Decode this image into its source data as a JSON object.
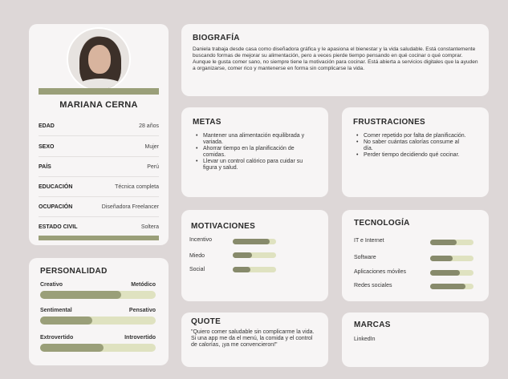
{
  "profile": {
    "name": "MARIANA CERNA",
    "info": [
      {
        "label": "EDAD",
        "value": "28 años"
      },
      {
        "label": "SEXO",
        "value": "Mujer"
      },
      {
        "label": "PAÍS",
        "value": "Perú"
      },
      {
        "label": "EDUCACIÓN",
        "value": "Técnica completa"
      },
      {
        "label": "OCUPACIÓN",
        "value": "Diseñadora Freelancer"
      },
      {
        "label": "ESTADO CIVIL",
        "value": "Soltera"
      }
    ]
  },
  "personalidad": {
    "title": "PERSONALIDAD",
    "traits": [
      {
        "left": "Creativo",
        "right": "Metódico",
        "level": 0.7
      },
      {
        "left": "Sentimental",
        "right": "Pensativo",
        "level": 0.45
      },
      {
        "left": "Extrovertido",
        "right": "Introvertido",
        "level": 0.55
      }
    ]
  },
  "biografia": {
    "title": "BIOGRAFÍA",
    "text": "Daniela trabaja desde casa como diseñadora gráfica y le apasiona el bienestar y la vida saludable. Está constantemente buscando formas de mejorar su alimentación, pero a veces pierde tiempo pensando en qué cocinar o qué comprar. Aunque le gusta comer sano, no siempre tiene la motivación para cocinar. Está abierta a servicios digitales que la ayuden a organizarse, comer rico y mantenerse en forma sin complicarse la vida."
  },
  "metas": {
    "title": "METAS",
    "items": [
      "Mantener una alimentación equilibrada y variada.",
      "Ahorrar tiempo en la planificación de comidas.",
      "Llevar un control calórico para cuidar su figura y salud."
    ]
  },
  "frustraciones": {
    "title": "FRUSTRACIONES",
    "items": [
      "Comer repetido por falta de planificación.",
      "No saber cuántas calorías consume al día.",
      "Perder tiempo decidiendo qué cocinar."
    ]
  },
  "motivaciones": {
    "title": "MOTIVACIONES",
    "items": [
      {
        "label": "Incentivo",
        "level": 0.85
      },
      {
        "label": "Miedo",
        "level": 0.45
      },
      {
        "label": "Social",
        "level": 0.4
      }
    ]
  },
  "tecnologia": {
    "title": "TECNOLOGÍA",
    "items": [
      {
        "label": "IT e Internet",
        "level": 0.62
      },
      {
        "label": "Software",
        "level": 0.52
      },
      {
        "label": "Aplicaciones móviles",
        "level": 0.68
      },
      {
        "label": "Redes sociales",
        "level": 0.82
      }
    ]
  },
  "quote": {
    "title": "QUOTE",
    "text": "\"Quiero comer saludable sin complicarme la vida. Si una app me da el menú, la comida y el control de calorías, ¡ya me convencieron!\""
  },
  "marcas": {
    "title": "MARCAS",
    "items": [
      "LinkedIn"
    ]
  },
  "colors": {
    "background": "#ddd7d7",
    "card": "#f7f5f5",
    "accent_dark": "#878a6b",
    "accent": "#9a9f79",
    "accent_light": "#dfe2c0"
  }
}
